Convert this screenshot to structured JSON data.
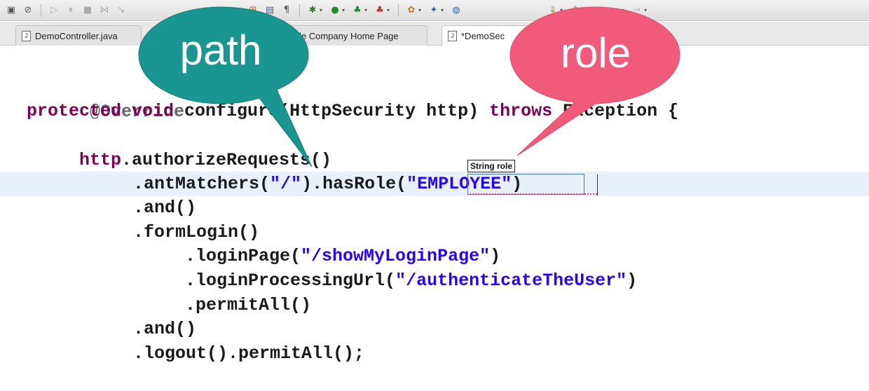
{
  "toolbar": {
    "icons": [
      "window-icon",
      "skip-breakpoints-icon",
      "resume-icon",
      "suspend-icon",
      "terminate-icon",
      "disconnect-icon",
      "step-into-icon",
      "run-icon",
      "save-icon",
      "open-type-icon",
      "show-whitespace-icon",
      "debug-icon",
      "run-icon",
      "run-last-icon",
      "external-tools-icon",
      "new-class-icon",
      "new-icon",
      "search-icon",
      "next-annotation-icon",
      "prev-annotation-icon",
      "last-edit-icon",
      "back-icon",
      "forward-icon"
    ]
  },
  "tabs": [
    {
      "label": "DemoController.java",
      "icon": "J"
    },
    {
      "label": "le Company Home Page",
      "icon": ""
    },
    {
      "label": "*DemoSec",
      "icon": "J"
    }
  ],
  "code": {
    "l1": "@Override",
    "l2_kw": "protected void ",
    "l2_rest": "configure(HttpSecurity http) ",
    "l2_throws": "throws",
    "l2_end": " Exception {",
    "l3_http": "http",
    "l3_rest": ".authorizeRequests()",
    "l4_a": ".antMatchers(",
    "l4_s1": "\"/\"",
    "l4_b": ").hasRole(",
    "l4_s2": "\"EMPLOYEE\"",
    "l4_c": ")",
    "l5": ".and()",
    "l6": ".formLogin()",
    "l7_a": ".loginPage(",
    "l7_s": "\"/showMyLoginPage\"",
    "l7_c": ")",
    "l8_a": ".loginProcessingUrl(",
    "l8_s": "\"/authenticateTheUser\"",
    "l8_c": ")",
    "l9": ".permitAll()",
    "l10": ".and()",
    "l11": ".logout().permitAll();"
  },
  "hint": "String role",
  "callouts": {
    "path": {
      "label": "path",
      "color": "#1a9690"
    },
    "role": {
      "label": "role",
      "color": "#f25a7a"
    }
  }
}
